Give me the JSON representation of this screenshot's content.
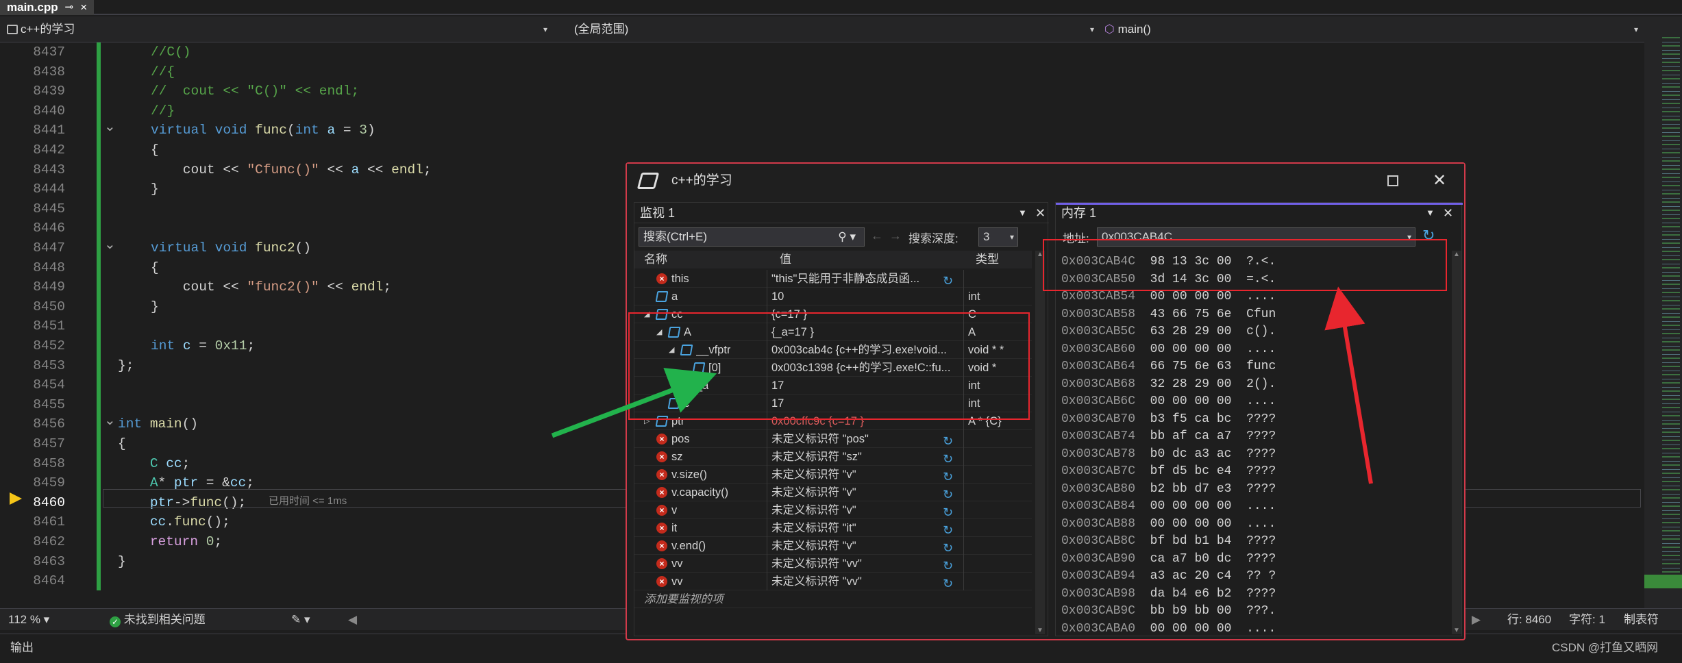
{
  "tab": {
    "title": "main.cpp",
    "pin": "⊸",
    "close": "×"
  },
  "nav": {
    "project": "c++的学习",
    "scope": "(全局范围)",
    "function": "main()"
  },
  "editor": {
    "lines": [
      {
        "n": "8437",
        "code": "//C()"
      },
      {
        "n": "8438",
        "code": "//{"
      },
      {
        "n": "8439",
        "code": "//  cout << \"C()\" << endl;"
      },
      {
        "n": "8440",
        "code": "//}"
      },
      {
        "n": "8441",
        "code": "virtual void func(int a = 3)"
      },
      {
        "n": "8442",
        "code": "{"
      },
      {
        "n": "8443",
        "code": "    cout << \"Cfunc()\" << a << endl;"
      },
      {
        "n": "8444",
        "code": "}"
      },
      {
        "n": "8445",
        "code": ""
      },
      {
        "n": "8446",
        "code": ""
      },
      {
        "n": "8447",
        "code": "virtual void func2()"
      },
      {
        "n": "8448",
        "code": "{"
      },
      {
        "n": "8449",
        "code": "    cout << \"func2()\" << endl;"
      },
      {
        "n": "8450",
        "code": "}"
      },
      {
        "n": "8451",
        "code": ""
      },
      {
        "n": "8452",
        "code": "int c = 0x11;"
      },
      {
        "n": "8453",
        "code": "};"
      },
      {
        "n": "8454",
        "code": ""
      },
      {
        "n": "8455",
        "code": ""
      },
      {
        "n": "8456",
        "code": "int main()"
      },
      {
        "n": "8457",
        "code": "{"
      },
      {
        "n": "8458",
        "code": "    C cc;"
      },
      {
        "n": "8459",
        "code": "    A* ptr = &cc;"
      },
      {
        "n": "8460",
        "code": "    ptr->func();"
      },
      {
        "n": "8461",
        "code": "    cc.func();"
      },
      {
        "n": "8462",
        "code": "    return 0;"
      },
      {
        "n": "8463",
        "code": "}"
      },
      {
        "n": "8464",
        "code": ""
      }
    ],
    "elapsed": "已用时间 <= 1ms"
  },
  "status": {
    "zoom": "112 %",
    "issues": "未找到相关问题",
    "line": "行: 8460",
    "col": "字符: 1",
    "tabs": "制表符"
  },
  "output": {
    "title": "输出",
    "credit": "CSDN @打鱼又晒网"
  },
  "debugwin": {
    "title": "c++的学习",
    "watch": {
      "title": "监视 1",
      "search_placeholder": "搜索(Ctrl+E)",
      "depth_label": "搜索深度:",
      "depth": "3",
      "col_name": "名称",
      "col_value": "值",
      "col_type": "类型",
      "add_hint": "添加要监视的项",
      "rows": [
        {
          "name": "this",
          "value": "\"this\"只能用于非静态成员函...",
          "type": "",
          "icon": "err",
          "indent": 0,
          "expand": "",
          "refresh": true
        },
        {
          "name": "a",
          "value": "10",
          "type": "int",
          "icon": "obj",
          "indent": 0,
          "expand": "",
          "refresh": false
        },
        {
          "name": "cc",
          "value": "{c=17 }",
          "type": "C",
          "icon": "obj",
          "indent": 0,
          "expand": "◢",
          "refresh": false
        },
        {
          "name": "A",
          "value": "{_a=17 }",
          "type": "A",
          "icon": "obj",
          "indent": 1,
          "expand": "◢",
          "refresh": false
        },
        {
          "name": "__vfptr",
          "value": "0x003cab4c {c++的学习.exe!void...",
          "type": "void * *",
          "icon": "obj",
          "indent": 2,
          "expand": "◢",
          "refresh": false
        },
        {
          "name": "[0]",
          "value": "0x003c1398 {c++的学习.exe!C::fu...",
          "type": "void *",
          "icon": "obj",
          "indent": 3,
          "expand": "",
          "refresh": false
        },
        {
          "name": "_a",
          "value": "17",
          "type": "int",
          "icon": "obj",
          "indent": 2,
          "expand": "",
          "refresh": false
        },
        {
          "name": "c",
          "value": "17",
          "type": "int",
          "icon": "obj",
          "indent": 1,
          "expand": "",
          "refresh": false
        },
        {
          "name": "ptr",
          "value": "0x00cffc9c {c=17 }",
          "type": "A * {C}",
          "icon": "obj",
          "indent": 0,
          "expand": "▷",
          "refresh": false
        },
        {
          "name": "pos",
          "value": "未定义标识符 \"pos\"",
          "type": "",
          "icon": "err",
          "indent": 0,
          "expand": "",
          "refresh": true
        },
        {
          "name": "sz",
          "value": "未定义标识符 \"sz\"",
          "type": "",
          "icon": "err",
          "indent": 0,
          "expand": "",
          "refresh": true
        },
        {
          "name": "v.size()",
          "value": "未定义标识符 \"v\"",
          "type": "",
          "icon": "err",
          "indent": 0,
          "expand": "",
          "refresh": true
        },
        {
          "name": "v.capacity()",
          "value": "未定义标识符 \"v\"",
          "type": "",
          "icon": "err",
          "indent": 0,
          "expand": "",
          "refresh": true
        },
        {
          "name": "v",
          "value": "未定义标识符 \"v\"",
          "type": "",
          "icon": "err",
          "indent": 0,
          "expand": "",
          "refresh": true
        },
        {
          "name": "it",
          "value": "未定义标识符 \"it\"",
          "type": "",
          "icon": "err",
          "indent": 0,
          "expand": "",
          "refresh": true
        },
        {
          "name": "v.end()",
          "value": "未定义标识符 \"v\"",
          "type": "",
          "icon": "err",
          "indent": 0,
          "expand": "",
          "refresh": true
        },
        {
          "name": "vv",
          "value": "未定义标识符 \"vv\"",
          "type": "",
          "icon": "err",
          "indent": 0,
          "expand": "",
          "refresh": true
        },
        {
          "name": "vv",
          "value": "未定义标识符 \"vv\"",
          "type": "",
          "icon": "err",
          "indent": 0,
          "expand": "",
          "refresh": true
        }
      ]
    },
    "memory": {
      "title": "内存 1",
      "address_label": "地址:",
      "address": "0x003CAB4C",
      "rows": [
        {
          "addr": "0x003CAB4C",
          "bytes": "98 13 3c 00",
          "text": "?.<."
        },
        {
          "addr": "0x003CAB50",
          "bytes": "3d 14 3c 00",
          "text": "=.<."
        },
        {
          "addr": "0x003CAB54",
          "bytes": "00 00 00 00",
          "text": "...."
        },
        {
          "addr": "0x003CAB58",
          "bytes": "43 66 75 6e",
          "text": "Cfun"
        },
        {
          "addr": "0x003CAB5C",
          "bytes": "63 28 29 00",
          "text": "c()."
        },
        {
          "addr": "0x003CAB60",
          "bytes": "00 00 00 00",
          "text": "...."
        },
        {
          "addr": "0x003CAB64",
          "bytes": "66 75 6e 63",
          "text": "func"
        },
        {
          "addr": "0x003CAB68",
          "bytes": "32 28 29 00",
          "text": "2()."
        },
        {
          "addr": "0x003CAB6C",
          "bytes": "00 00 00 00",
          "text": "...."
        },
        {
          "addr": "0x003CAB70",
          "bytes": "b3 f5 ca bc",
          "text": "????"
        },
        {
          "addr": "0x003CAB74",
          "bytes": "bb af ca a7",
          "text": "????"
        },
        {
          "addr": "0x003CAB78",
          "bytes": "b0 dc a3 ac",
          "text": "????"
        },
        {
          "addr": "0x003CAB7C",
          "bytes": "bf d5 bc e4",
          "text": "????"
        },
        {
          "addr": "0x003CAB80",
          "bytes": "b2 bb d7 e3",
          "text": "????"
        },
        {
          "addr": "0x003CAB84",
          "bytes": "00 00 00 00",
          "text": "...."
        },
        {
          "addr": "0x003CAB88",
          "bytes": "00 00 00 00",
          "text": "...."
        },
        {
          "addr": "0x003CAB8C",
          "bytes": "bf bd b1 b4",
          "text": "????"
        },
        {
          "addr": "0x003CAB90",
          "bytes": "ca a7 b0 dc",
          "text": "????"
        },
        {
          "addr": "0x003CAB94",
          "bytes": "a3 ac 20 c4",
          "text": "?? ?"
        },
        {
          "addr": "0x003CAB98",
          "bytes": "da b4 e6 b2",
          "text": "????"
        },
        {
          "addr": "0x003CAB9C",
          "bytes": "bb b9 bb 00",
          "text": "???."
        },
        {
          "addr": "0x003CABA0",
          "bytes": "00 00 00 00",
          "text": "...."
        }
      ]
    }
  },
  "colors": {
    "annotation_red": "#e8262e",
    "annotation_green": "#22b24c",
    "breakpoint_arrow": "#f5c518"
  }
}
